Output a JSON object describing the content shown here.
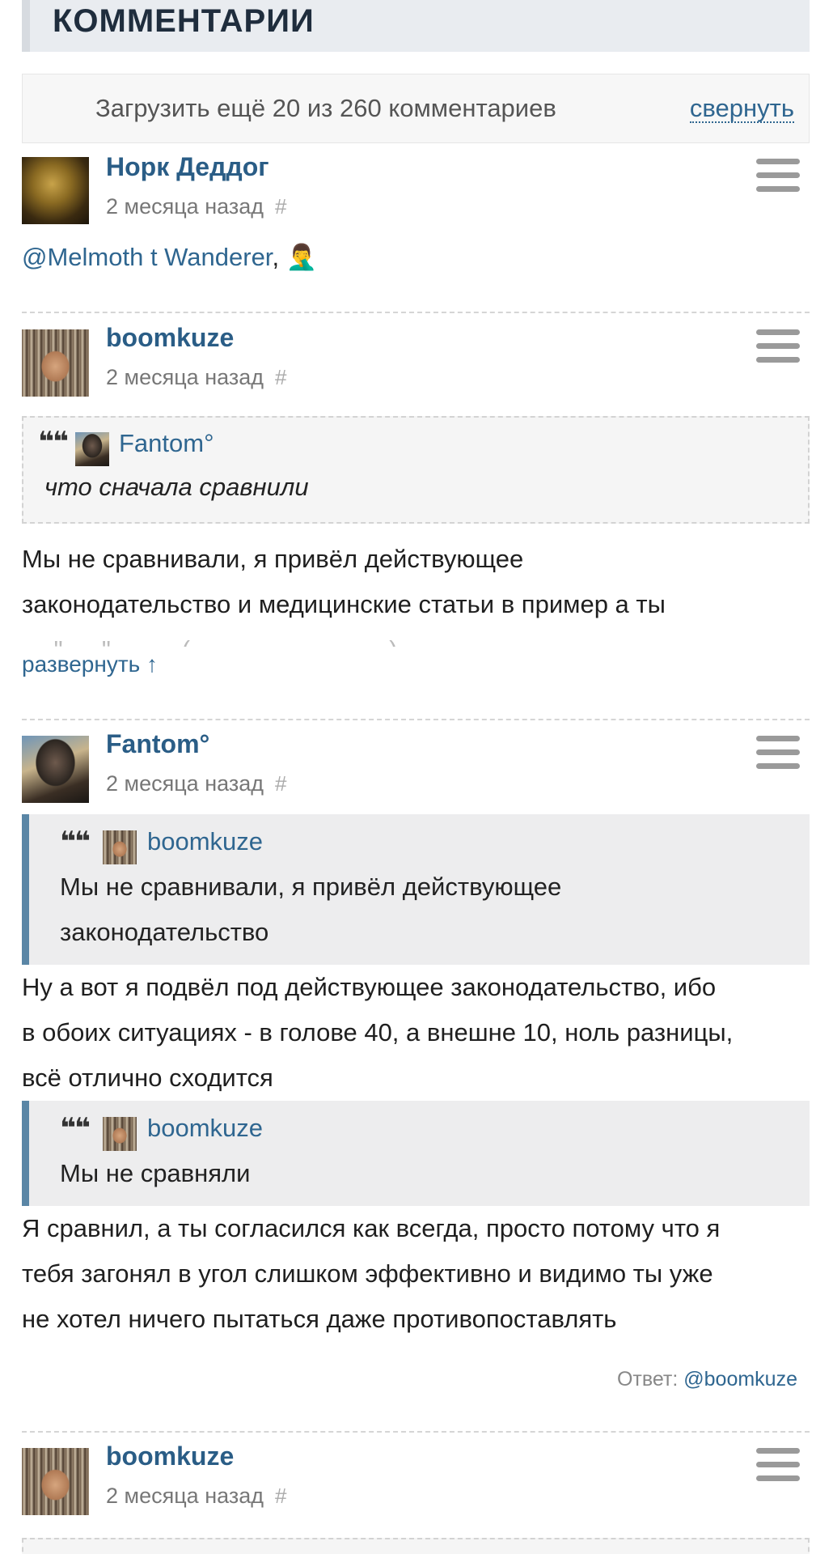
{
  "header": {
    "title": "КОММЕНТАРИИ"
  },
  "load_more": {
    "text": "Загрузить ещё 20 из 260 комментариев",
    "collapse": "свернуть"
  },
  "comments": [
    {
      "author": "Норк Деддог",
      "time": "2 месяца назад",
      "hash": "#",
      "mention": "@Melmoth t Wanderer",
      "after_mention": ", 🤦‍♂️"
    },
    {
      "author": "boomkuze",
      "time": "2 месяца назад",
      "hash": "#",
      "quote": {
        "author": "Fantom°",
        "text": "что сначала сравнили"
      },
      "text_lines": [
        "Мы не сравнивали, я привёл действующее",
        "законодательство и медицинские статьи в пример а ты"
      ],
      "expand": "развернуть ↑"
    },
    {
      "author": "Fantom°",
      "time": "2 месяца назад",
      "hash": "#",
      "quote1": {
        "author": "boomkuze",
        "lines": [
          "Мы не сравнивали, я привёл действующее",
          "законодательство"
        ]
      },
      "text1_lines": [
        "Ну а вот я подвёл под действующее законодательство, ибо",
        "в обоих ситуациях - в голове 40, а внешне 10, ноль разницы,",
        "всё отлично сходится"
      ],
      "quote2": {
        "author": "boomkuze",
        "text": "Мы не сравняли"
      },
      "text2_lines": [
        "Я сравнил, а ты согласился как всегда, просто потому что я",
        "тебя загонял в угол слишком эффективно и видимо ты уже",
        "не хотел ничего пытаться даже противопоставлять"
      ],
      "reply_label": "Ответ: ",
      "reply_mention": "@boomkuze"
    },
    {
      "author": "boomkuze",
      "time": "2 месяца назад",
      "hash": "#"
    }
  ],
  "icons": {
    "menu": "hamburger-icon",
    "quote": "quote-icon"
  }
}
